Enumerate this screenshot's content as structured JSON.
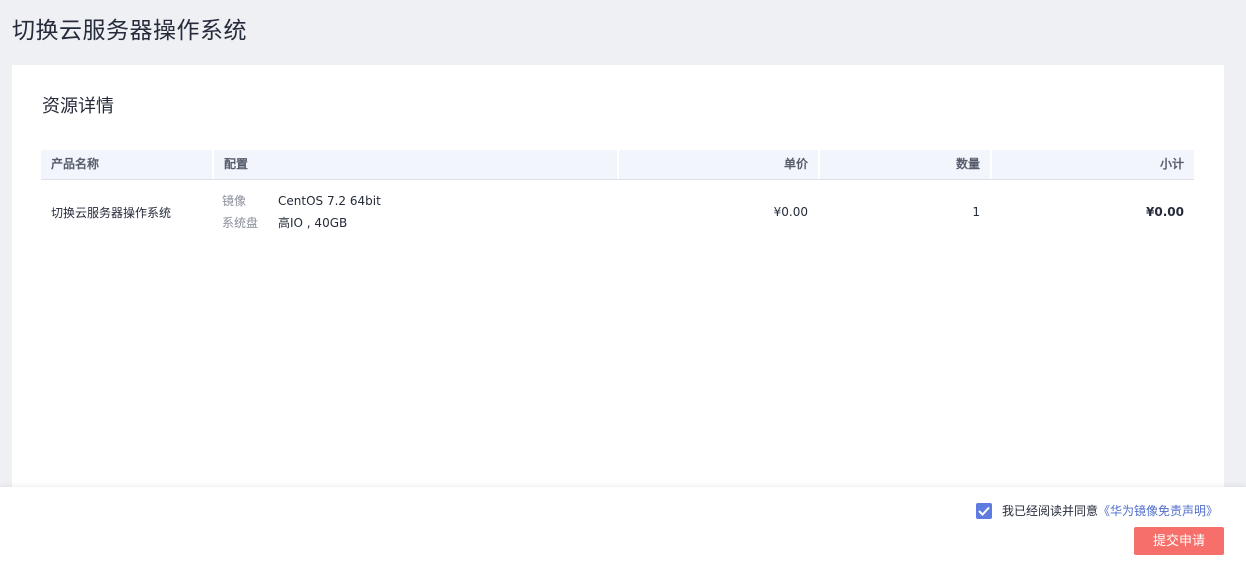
{
  "page": {
    "title": "切换云服务器操作系统"
  },
  "section": {
    "title": "资源详情"
  },
  "table": {
    "headers": [
      "产品名称",
      "配置",
      "单价",
      "数量",
      "小计"
    ],
    "rows": [
      {
        "product": "切换云服务器操作系统",
        "config": [
          {
            "key": "镜像",
            "value": "CentOS 7.2 64bit"
          },
          {
            "key": "系统盘",
            "value": "高IO , 40GB"
          }
        ],
        "unit_price": "¥0.00",
        "quantity": "1",
        "subtotal": "¥0.00"
      }
    ]
  },
  "footer": {
    "agree_checked": true,
    "agree_text": "我已经阅读并同意",
    "agree_link": "《华为镜像免责声明》",
    "submit_label": "提交申请"
  },
  "colors": {
    "accent": "#5e7ce0",
    "submit": "#f66f6a",
    "link": "#526ecc"
  }
}
